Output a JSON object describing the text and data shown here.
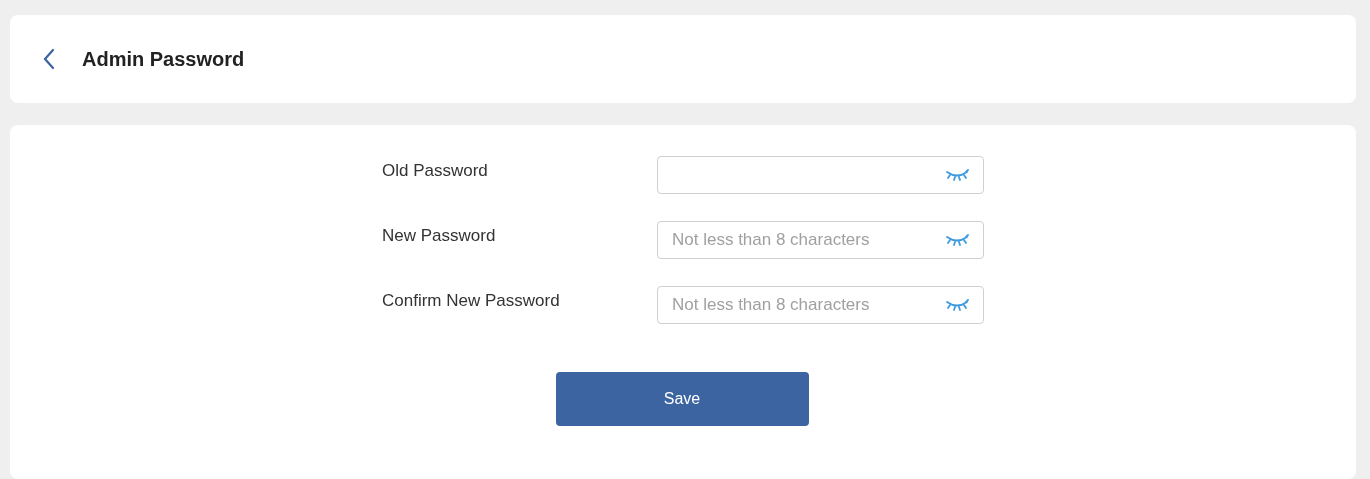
{
  "header": {
    "title": "Admin Password"
  },
  "fields": [
    {
      "label": "Old Password"
    },
    {
      "label": "New Password",
      "placeholder": "Not less than 8 characters"
    },
    {
      "label": "Confirm New Password",
      "placeholder": "Not less than 8 characters"
    }
  ],
  "save_button": {
    "label": "Save"
  }
}
